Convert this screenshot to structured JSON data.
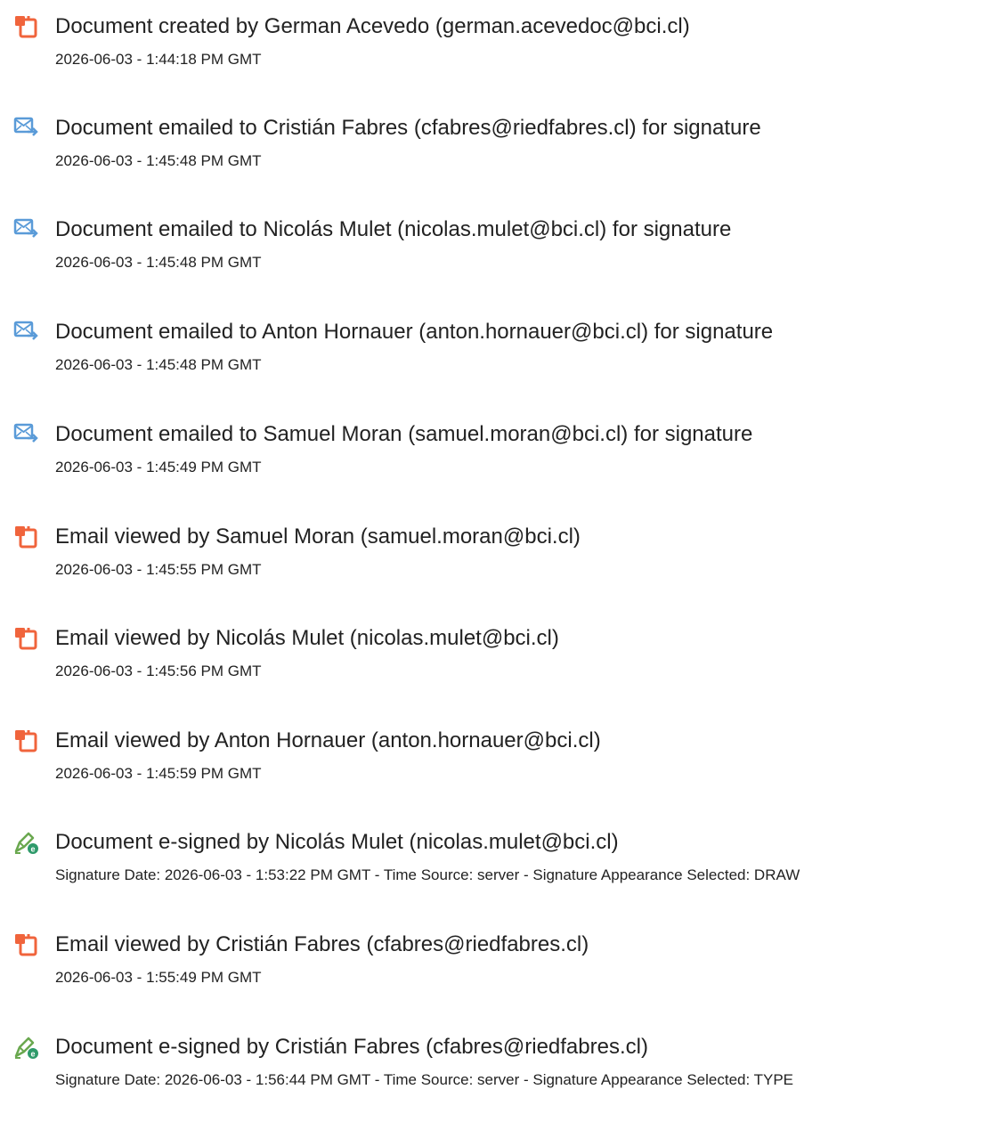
{
  "events": [
    {
      "icon": "document-created-icon",
      "title": "Document created by German Acevedo (german.acevedoc@bci.cl)",
      "detail": "2026-06-03 - 1:44:18 PM GMT"
    },
    {
      "icon": "email-sent-icon",
      "title": "Document emailed to Cristián Fabres (cfabres@riedfabres.cl) for signature",
      "detail": "2026-06-03 - 1:45:48 PM GMT"
    },
    {
      "icon": "email-sent-icon",
      "title": "Document emailed to Nicolás Mulet (nicolas.mulet@bci.cl) for signature",
      "detail": "2026-06-03 - 1:45:48 PM GMT"
    },
    {
      "icon": "email-sent-icon",
      "title": "Document emailed to Anton Hornauer (anton.hornauer@bci.cl) for signature",
      "detail": "2026-06-03 - 1:45:48 PM GMT"
    },
    {
      "icon": "email-sent-icon",
      "title": "Document emailed to Samuel Moran (samuel.moran@bci.cl) for signature",
      "detail": "2026-06-03 - 1:45:49 PM GMT"
    },
    {
      "icon": "email-viewed-icon",
      "title": "Email viewed by Samuel Moran (samuel.moran@bci.cl)",
      "detail": "2026-06-03 - 1:45:55 PM GMT"
    },
    {
      "icon": "email-viewed-icon",
      "title": "Email viewed by Nicolás Mulet (nicolas.mulet@bci.cl)",
      "detail": "2026-06-03 - 1:45:56 PM GMT"
    },
    {
      "icon": "email-viewed-icon",
      "title": "Email viewed by Anton Hornauer (anton.hornauer@bci.cl)",
      "detail": "2026-06-03 - 1:45:59 PM GMT"
    },
    {
      "icon": "e-sign-icon",
      "title": "Document e-signed by Nicolás Mulet (nicolas.mulet@bci.cl)",
      "detail": "Signature Date: 2026-06-03 - 1:53:22 PM GMT - Time Source: server - Signature Appearance Selected: DRAW"
    },
    {
      "icon": "email-viewed-icon",
      "title": "Email viewed by Cristián Fabres (cfabres@riedfabres.cl)",
      "detail": "2026-06-03 - 1:55:49 PM GMT"
    },
    {
      "icon": "e-sign-icon",
      "title": "Document e-signed by Cristián Fabres (cfabres@riedfabres.cl)",
      "detail": "Signature Date: 2026-06-03 - 1:56:44 PM GMT - Time Source: server - Signature Appearance Selected: TYPE"
    }
  ],
  "colors": {
    "document_icon": "#f0643c",
    "email_icon": "#5a9bd8",
    "sign_icon_pen": "#6aa84f",
    "sign_icon_badge": "#2e9a6a",
    "text": "#222222"
  }
}
